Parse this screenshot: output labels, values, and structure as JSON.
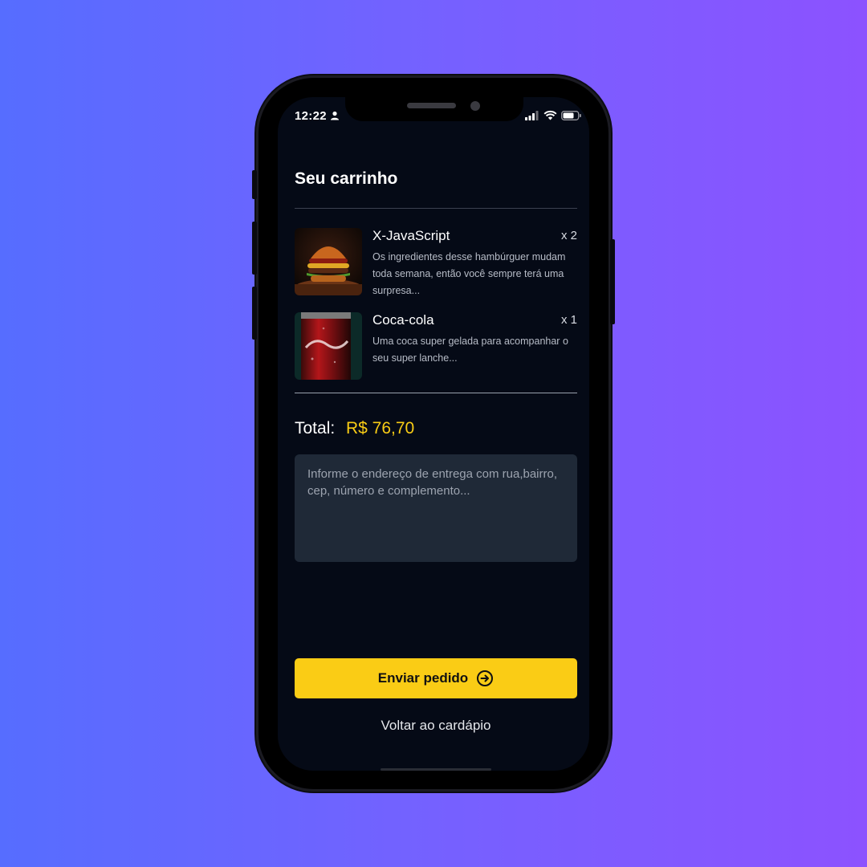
{
  "status_bar": {
    "time": "12:22"
  },
  "cart": {
    "title": "Seu carrinho",
    "items": [
      {
        "name": "X-JavaScript",
        "quantity": "x 2",
        "description": "Os ingredientes desse hambúrguer mudam toda semana, então você sempre terá uma surpresa...",
        "image_icon": "burger-image"
      },
      {
        "name": "Coca-cola",
        "quantity": "x 1",
        "description": "Uma coca super gelada para acompanhar o seu super lanche...",
        "image_icon": "coca-cola-can-image"
      }
    ],
    "total_label": "Total:",
    "total_value": "R$ 76,70"
  },
  "address": {
    "placeholder": "Informe o endereço de entrega com rua,bairro, cep, número e complemento..."
  },
  "actions": {
    "send_label": "Enviar pedido",
    "back_label": "Voltar ao cardápio"
  },
  "colors": {
    "accent": "#facc15",
    "price": "#f9cc15",
    "screen_bg": "#050a16",
    "input_bg": "#1f2937"
  }
}
